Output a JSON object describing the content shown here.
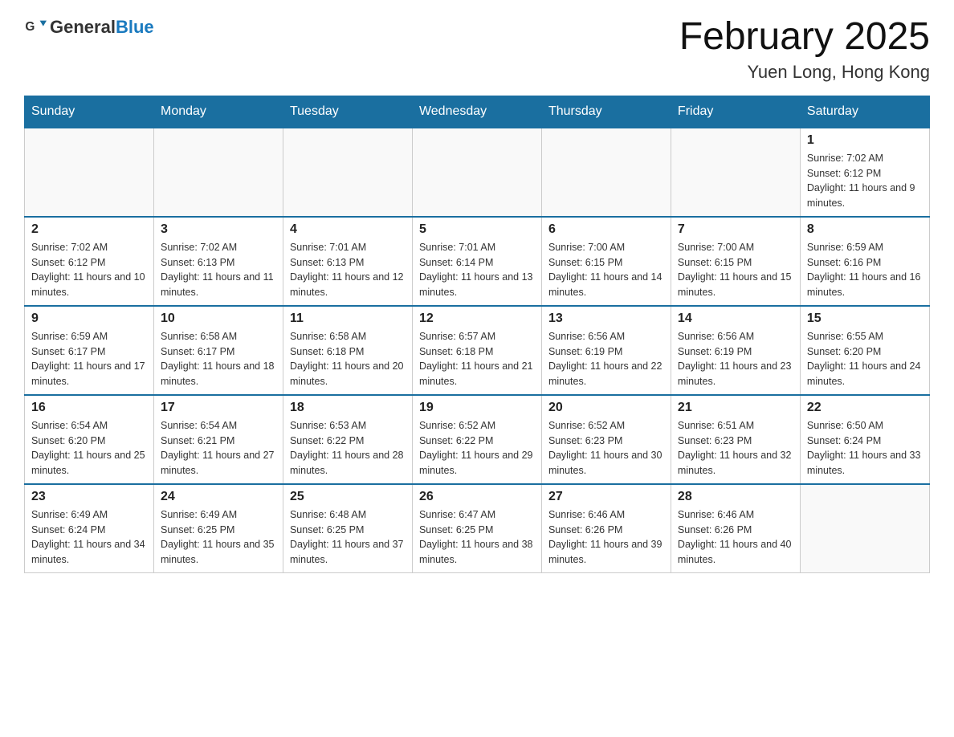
{
  "logo": {
    "text_general": "General",
    "text_blue": "Blue"
  },
  "title": "February 2025",
  "location": "Yuen Long, Hong Kong",
  "days_of_week": [
    "Sunday",
    "Monday",
    "Tuesday",
    "Wednesday",
    "Thursday",
    "Friday",
    "Saturday"
  ],
  "weeks": [
    [
      {
        "day": "",
        "info": ""
      },
      {
        "day": "",
        "info": ""
      },
      {
        "day": "",
        "info": ""
      },
      {
        "day": "",
        "info": ""
      },
      {
        "day": "",
        "info": ""
      },
      {
        "day": "",
        "info": ""
      },
      {
        "day": "1",
        "info": "Sunrise: 7:02 AM\nSunset: 6:12 PM\nDaylight: 11 hours and 9 minutes."
      }
    ],
    [
      {
        "day": "2",
        "info": "Sunrise: 7:02 AM\nSunset: 6:12 PM\nDaylight: 11 hours and 10 minutes."
      },
      {
        "day": "3",
        "info": "Sunrise: 7:02 AM\nSunset: 6:13 PM\nDaylight: 11 hours and 11 minutes."
      },
      {
        "day": "4",
        "info": "Sunrise: 7:01 AM\nSunset: 6:13 PM\nDaylight: 11 hours and 12 minutes."
      },
      {
        "day": "5",
        "info": "Sunrise: 7:01 AM\nSunset: 6:14 PM\nDaylight: 11 hours and 13 minutes."
      },
      {
        "day": "6",
        "info": "Sunrise: 7:00 AM\nSunset: 6:15 PM\nDaylight: 11 hours and 14 minutes."
      },
      {
        "day": "7",
        "info": "Sunrise: 7:00 AM\nSunset: 6:15 PM\nDaylight: 11 hours and 15 minutes."
      },
      {
        "day": "8",
        "info": "Sunrise: 6:59 AM\nSunset: 6:16 PM\nDaylight: 11 hours and 16 minutes."
      }
    ],
    [
      {
        "day": "9",
        "info": "Sunrise: 6:59 AM\nSunset: 6:17 PM\nDaylight: 11 hours and 17 minutes."
      },
      {
        "day": "10",
        "info": "Sunrise: 6:58 AM\nSunset: 6:17 PM\nDaylight: 11 hours and 18 minutes."
      },
      {
        "day": "11",
        "info": "Sunrise: 6:58 AM\nSunset: 6:18 PM\nDaylight: 11 hours and 20 minutes."
      },
      {
        "day": "12",
        "info": "Sunrise: 6:57 AM\nSunset: 6:18 PM\nDaylight: 11 hours and 21 minutes."
      },
      {
        "day": "13",
        "info": "Sunrise: 6:56 AM\nSunset: 6:19 PM\nDaylight: 11 hours and 22 minutes."
      },
      {
        "day": "14",
        "info": "Sunrise: 6:56 AM\nSunset: 6:19 PM\nDaylight: 11 hours and 23 minutes."
      },
      {
        "day": "15",
        "info": "Sunrise: 6:55 AM\nSunset: 6:20 PM\nDaylight: 11 hours and 24 minutes."
      }
    ],
    [
      {
        "day": "16",
        "info": "Sunrise: 6:54 AM\nSunset: 6:20 PM\nDaylight: 11 hours and 25 minutes."
      },
      {
        "day": "17",
        "info": "Sunrise: 6:54 AM\nSunset: 6:21 PM\nDaylight: 11 hours and 27 minutes."
      },
      {
        "day": "18",
        "info": "Sunrise: 6:53 AM\nSunset: 6:22 PM\nDaylight: 11 hours and 28 minutes."
      },
      {
        "day": "19",
        "info": "Sunrise: 6:52 AM\nSunset: 6:22 PM\nDaylight: 11 hours and 29 minutes."
      },
      {
        "day": "20",
        "info": "Sunrise: 6:52 AM\nSunset: 6:23 PM\nDaylight: 11 hours and 30 minutes."
      },
      {
        "day": "21",
        "info": "Sunrise: 6:51 AM\nSunset: 6:23 PM\nDaylight: 11 hours and 32 minutes."
      },
      {
        "day": "22",
        "info": "Sunrise: 6:50 AM\nSunset: 6:24 PM\nDaylight: 11 hours and 33 minutes."
      }
    ],
    [
      {
        "day": "23",
        "info": "Sunrise: 6:49 AM\nSunset: 6:24 PM\nDaylight: 11 hours and 34 minutes."
      },
      {
        "day": "24",
        "info": "Sunrise: 6:49 AM\nSunset: 6:25 PM\nDaylight: 11 hours and 35 minutes."
      },
      {
        "day": "25",
        "info": "Sunrise: 6:48 AM\nSunset: 6:25 PM\nDaylight: 11 hours and 37 minutes."
      },
      {
        "day": "26",
        "info": "Sunrise: 6:47 AM\nSunset: 6:25 PM\nDaylight: 11 hours and 38 minutes."
      },
      {
        "day": "27",
        "info": "Sunrise: 6:46 AM\nSunset: 6:26 PM\nDaylight: 11 hours and 39 minutes."
      },
      {
        "day": "28",
        "info": "Sunrise: 6:46 AM\nSunset: 6:26 PM\nDaylight: 11 hours and 40 minutes."
      },
      {
        "day": "",
        "info": ""
      }
    ]
  ]
}
